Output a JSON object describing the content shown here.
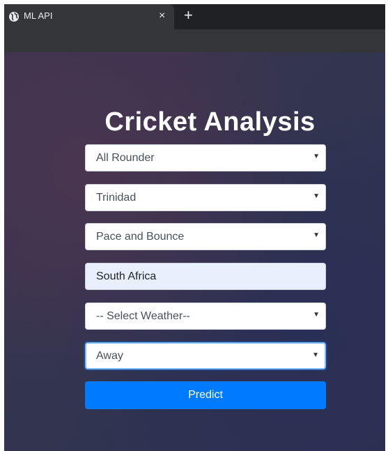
{
  "browser": {
    "tab_title": "ML API",
    "close_symbol": "×",
    "new_tab_symbol": "+",
    "tab_icon": "globe-icon"
  },
  "page": {
    "heading": "Cricket Analysis",
    "fields": {
      "player_role": {
        "value": "All Rounder",
        "icon": "dropdown-arrow-icon"
      },
      "venue": {
        "value": "Trinidad"
      },
      "pitch_type": {
        "value": "Pace and Bounce"
      },
      "opponent": {
        "value": "South Africa"
      },
      "weather": {
        "value": "-- Select Weather--"
      },
      "match_location": {
        "value": "Away"
      }
    },
    "predict_label": "Predict",
    "dropdown_arrow": "▼"
  },
  "colors": {
    "primary": "#007bff",
    "autofill": "#e8f0fe",
    "heading": "#ffffff"
  }
}
